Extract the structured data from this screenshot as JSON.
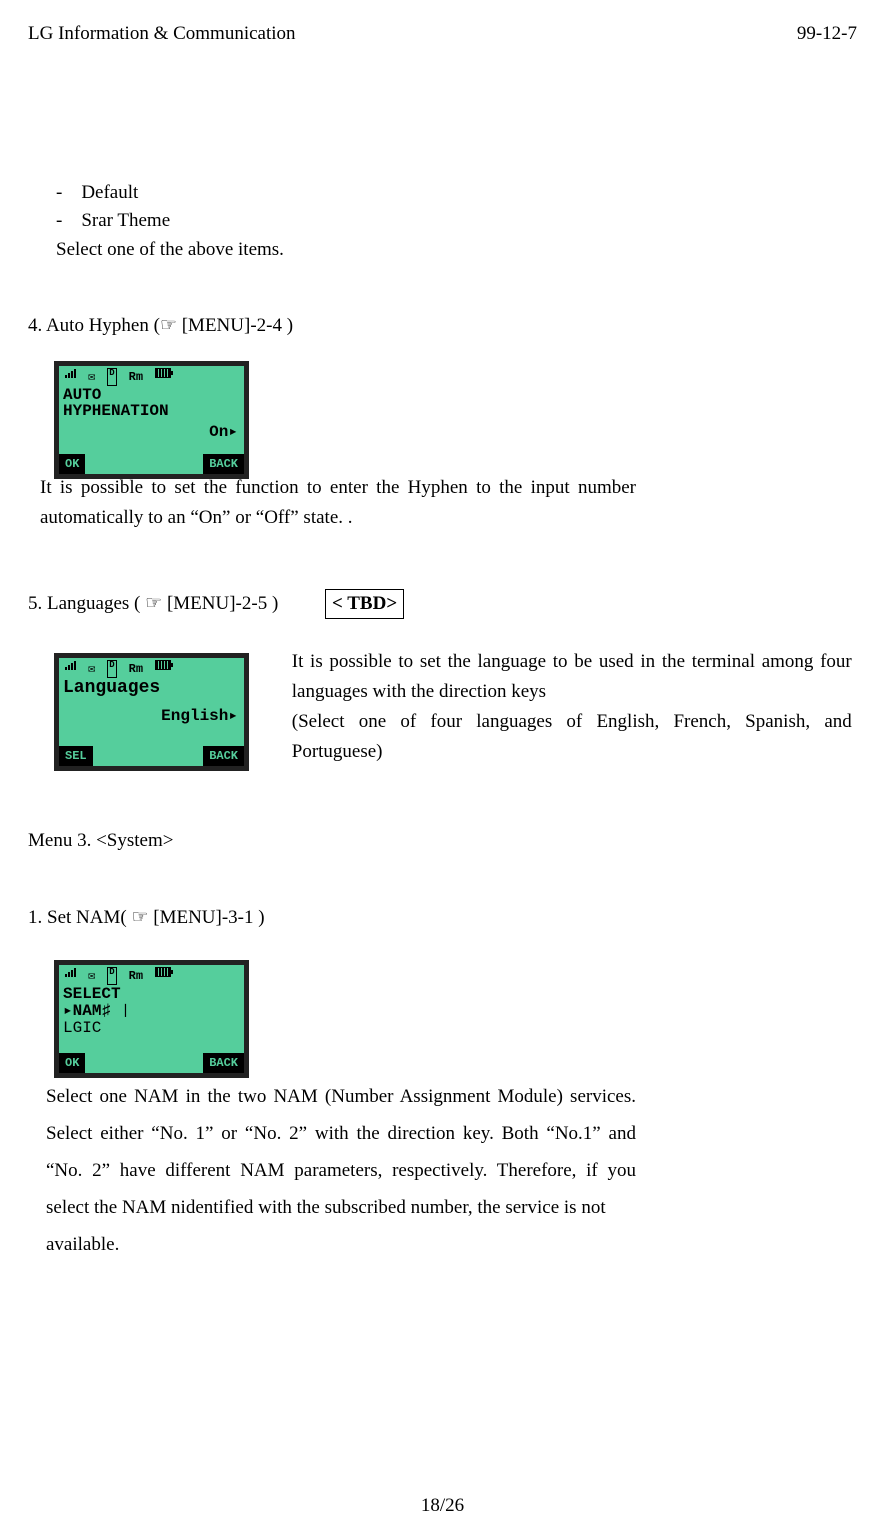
{
  "header": {
    "left": "LG Information & Communication",
    "right": "99-12-7"
  },
  "bullets": {
    "b1": "Default",
    "b2": "Srar Theme"
  },
  "select_line": "Select one of the above items.",
  "s4": {
    "heading_pre": "4. Auto Hyphen (",
    "heading_post": " [MENU]-2-4 )",
    "para": "It is possible to set the function to enter the Hyphen to the input number automatically to an “On” or “Off” state. .",
    "lcd": {
      "line1": "AUTO",
      "line2": "HYPHENATION",
      "value": "On▸",
      "sk_left": "OK",
      "sk_right": "BACK"
    }
  },
  "s5": {
    "heading_pre": "5. Languages ( ",
    "heading_post": " [MENU]-2-5 )",
    "tbd": "< TBD>",
    "para_l1": "It is possible to set the language to be used in the terminal among four languages with the direction keys",
    "para_l2": "(Select one of four languages of English, French, Spanish, and Portuguese)",
    "lcd": {
      "line1": "Languages",
      "value": "English▸",
      "sk_left": "SEL",
      "sk_right": "BACK"
    }
  },
  "menu3": "Menu 3. <System>",
  "s31": {
    "heading_pre": "1. Set NAM( ",
    "heading_post": " [MENU]-3-1 )",
    "para": "Select one NAM in the two NAM (Number Assignment Module) services. Select either “No. 1” or “No. 2” with the direction key. Both “No.1” and “No. 2” have different NAM parameters, respectively. Therefore, if you select the NAM nidentified with the subscribed number, the service is not",
    "para_tail": "available.",
    "lcd": {
      "line1": "SELECT",
      "line2": "▸NAM♯ ❘",
      "line3": " LGIC",
      "sk_left": "OK",
      "sk_right": "BACK"
    }
  },
  "status_icons": {
    "d": "D",
    "rm": "Rm"
  },
  "hand_glyph": "☞",
  "page_number": "18/26"
}
